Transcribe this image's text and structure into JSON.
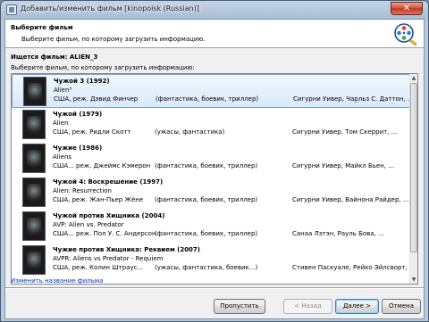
{
  "window": {
    "title": "Добавить/изменить фильм [kinopoisk (Russian)]",
    "close_label": "✕"
  },
  "header": {
    "title": "Выберите фильм",
    "description": "Выберите фильм, по которому загрузить информацию."
  },
  "search": {
    "label": "Ищется фильм:",
    "value": "ALIEN_3"
  },
  "list_label": "Выберите фильм, по которому загрузить информацию:",
  "movies": [
    {
      "title": "Чужой 3 (1992)",
      "original": "Alien³",
      "details": "США, реж. Дэвид Финчер",
      "genres": "(фантастика, боевик, триллер)",
      "cast": "Сигурни Уивер, Чарльз С. Даттон, ..."
    },
    {
      "title": "Чужой (1979)",
      "original": "Alien",
      "details": "США, реж. Ридли Скотт",
      "genres": "(ужасы, фантастика)",
      "cast": "Сигурни Уивер, Том Скеррит, ..."
    },
    {
      "title": "Чужие (1986)",
      "original": "Aliens",
      "details": "США... реж. Джеймс Кэмерон",
      "genres": "(фантастика, боевик, триллер)",
      "cast": "Сигурни Уивер, Майкл Бьен, ..."
    },
    {
      "title": "Чужой 4: Воскрешение (1997)",
      "original": "Alien: Resurrection",
      "details": "США, реж. Жан-Пьер Жёне",
      "genres": "(фантастика, боевик, триллер)",
      "cast": "Сигурни Уивер, Вайнона Райдер, ..."
    },
    {
      "title": "Чужой против Хищника (2004)",
      "original": "AVP: Alien vs. Predator",
      "details": "США... реж. Пол У. С. Андерсон",
      "genres": "(фантастика, боевик, триллер)",
      "cast": "Санаа Лэтэн, Рауль Бова, ..."
    },
    {
      "title": "Чужие против Хищника: Реквием (2007)",
      "original": "AVPR: Aliens vs Predator - Requiem",
      "details": "США, реж. Колин Штраус...",
      "genres": "(ужасы, фантастика, боевик...)",
      "cast": "Стивен Паскуале, Рейко Эйлсворт, ..."
    }
  ],
  "rename_link": "Изменить название фильма",
  "buttons": {
    "skip": "Пропустить",
    "back": "< Назад",
    "next": "Далее >",
    "cancel": "Отмена"
  },
  "icons": {
    "app": "window-icon",
    "logo": "film-reel-icon",
    "scroll_up": "▲",
    "scroll_down": "▼"
  }
}
